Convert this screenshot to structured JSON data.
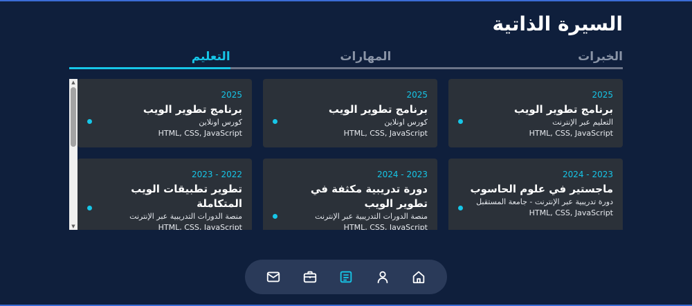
{
  "page": {
    "title": "السيرة الذاتية"
  },
  "tabs": [
    "الخبرات",
    "المهارات",
    "التعليم"
  ],
  "cards": [
    {
      "year": "2025",
      "title": "برنامج تطوير الويب",
      "org": "التعليم عبر الإنترنت",
      "skills": "HTML, CSS, JavaScript"
    },
    {
      "year": "2025",
      "title": "برنامج تطوير الويب",
      "org": "كورس اونلاين",
      "skills": "HTML, CSS, JavaScript"
    },
    {
      "year": "2025",
      "title": "برنامج تطوير الويب",
      "org": "كورس اونلاين",
      "skills": "HTML, CSS, JavaScript"
    },
    {
      "year": "2023 - 2024",
      "title": "ماجستير في علوم الحاسوب",
      "org": "دورة تدريبية عبر الإنترنت - جامعة المستقبل",
      "skills": "HTML, CSS, JavaScript"
    },
    {
      "year": "2023 - 2024",
      "title": "دورة تدريبية مكثفة في تطوير الويب",
      "org": "منصة الدورات التدريبية عبر الإنترنت",
      "skills": "HTML, CSS, JavaScript"
    },
    {
      "year": "2022 - 2023",
      "title": "تطوير تطبيقات الويب المتكاملة",
      "org": "منصة الدورات التدريبية عبر الإنترنت",
      "skills": "HTML, CSS, JavaScript"
    }
  ],
  "nav": [
    "mail-icon",
    "briefcase-icon",
    "document-icon",
    "user-icon",
    "home-icon"
  ],
  "colors": {
    "accent": "#16c6e8",
    "background": "#0f1f3c",
    "card": "#2b3139",
    "nav": "#2a3a59"
  }
}
